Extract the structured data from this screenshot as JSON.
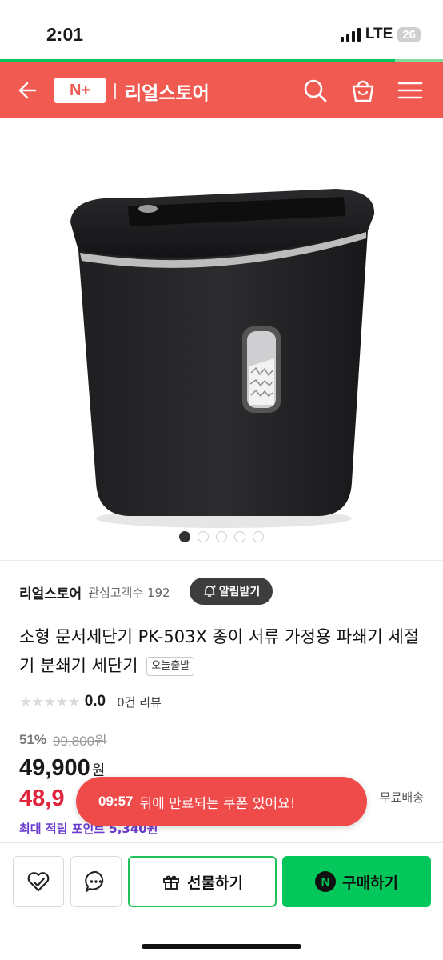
{
  "status_bar": {
    "time": "2:01",
    "network": "LTE",
    "battery": "26"
  },
  "header": {
    "logo": "N+",
    "store_name": "리얼스토어"
  },
  "gallery": {
    "image_count": 5,
    "active_index": 0
  },
  "seller": {
    "name": "리얼스토어",
    "followers": "관심고객수 192",
    "alarm_button": "알림받기"
  },
  "product": {
    "title": "소형 문서세단기 PK-503X 종이 서류 가정용 파쇄기 세절기 분쇄기 세단기",
    "badge": "오늘출발",
    "rating": "0.0",
    "review_count": "0건 리뷰",
    "discount": "51%",
    "original_price": "99,800원",
    "price": "49,900",
    "price_unit": "원",
    "sale_price_partial": "48,9",
    "shipping": "무료배송",
    "points": "최대 적립 포인트 5,340원"
  },
  "toast": {
    "timer": "09:57",
    "message": "뒤에 만료되는 쿠폰 있어요!"
  },
  "bottom_bar": {
    "gift_label": "선물하기",
    "buy_label": "구매하기",
    "buy_badge": "N"
  },
  "colors": {
    "brand_red": "#f05a50",
    "naver_green": "#03c75a",
    "sale_red": "#e0243c",
    "points_purple": "#6a3ccf"
  }
}
